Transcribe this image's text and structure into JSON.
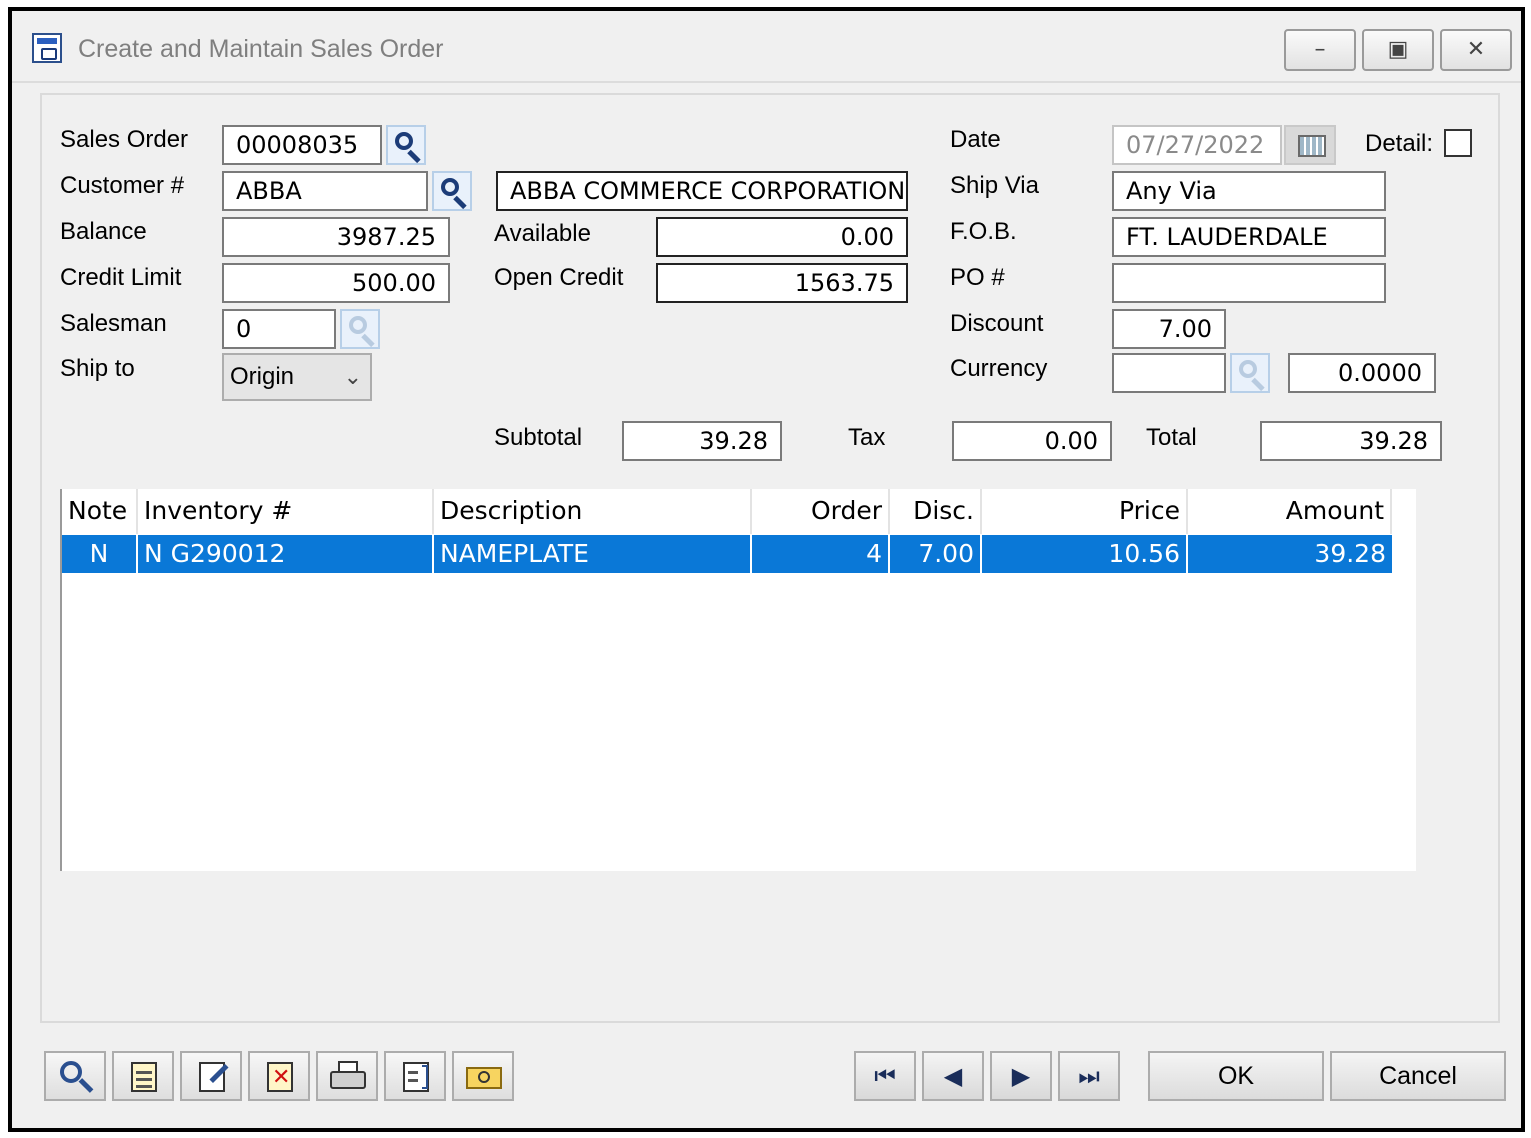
{
  "window": {
    "title": "Create and Maintain Sales Order",
    "buttons": {
      "minimize": "–",
      "restore": "▣",
      "close": "✕"
    }
  },
  "form": {
    "sales_order": {
      "label": "Sales Order",
      "value": "00008035"
    },
    "customer": {
      "label": "Customer #",
      "value": "ABBA",
      "name": "ABBA COMMERCE CORPORATION"
    },
    "balance": {
      "label": "Balance",
      "value": "3987.25"
    },
    "credit_limit": {
      "label": "Credit Limit",
      "value": "500.00"
    },
    "salesman": {
      "label": "Salesman",
      "value": "0"
    },
    "ship_to": {
      "label": "Ship to",
      "value": "Origin"
    },
    "available": {
      "label": "Available",
      "value": "0.00"
    },
    "open_credit": {
      "label": "Open Credit",
      "value": "1563.75"
    },
    "date": {
      "label": "Date",
      "value": "07/27/2022"
    },
    "detail": {
      "label": "Detail:"
    },
    "ship_via": {
      "label": "Ship Via",
      "value": "Any Via"
    },
    "fob": {
      "label": "F.O.B.",
      "value": "FT. LAUDERDALE"
    },
    "po": {
      "label": "PO #",
      "value": ""
    },
    "discount": {
      "label": "Discount",
      "value": "7.00"
    },
    "currency": {
      "label": "Currency",
      "code": "",
      "rate": "0.0000"
    }
  },
  "totals": {
    "subtotal_label": "Subtotal",
    "subtotal": "39.28",
    "tax_label": "Tax",
    "tax": "0.00",
    "total_label": "Total",
    "total": "39.28"
  },
  "grid": {
    "columns": [
      "Note",
      "Inventory #",
      "Description",
      "Order",
      "Disc.",
      "Price",
      "Amount"
    ],
    "rows": [
      {
        "note": "N",
        "inventory": "N G290012",
        "description": "NAMEPLATE",
        "order": "4",
        "disc": "7.00",
        "price": "10.56",
        "amount": "39.28"
      }
    ]
  },
  "toolbar": {
    "icons": [
      "find-icon",
      "document-icon",
      "edit-icon",
      "delete-icon",
      "print-icon",
      "copy-icon",
      "attach-icon"
    ]
  },
  "navigation": {
    "first": "⏮",
    "prev": "◀",
    "next": "▶",
    "last": "⏭"
  },
  "actions": {
    "ok": "OK",
    "cancel": "Cancel"
  }
}
